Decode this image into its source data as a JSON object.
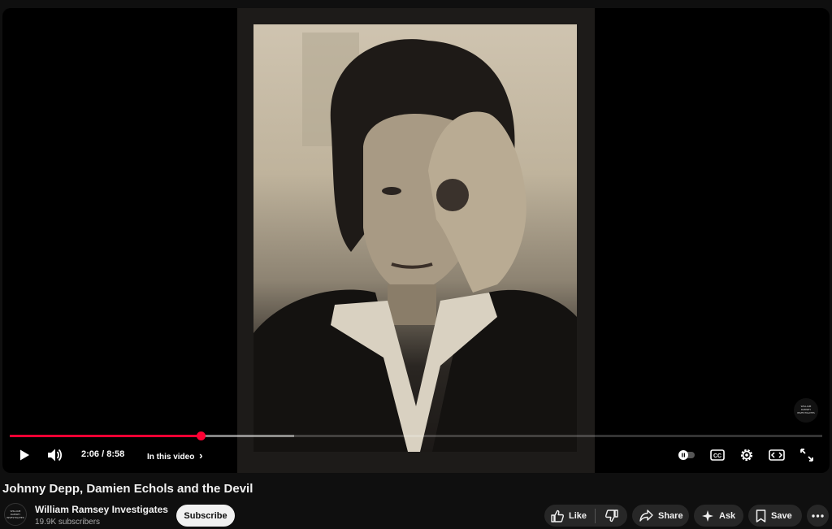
{
  "player": {
    "current_time": "2:06",
    "separator": " / ",
    "duration": "8:58",
    "chapter_label": "In this video",
    "chapter_chevron": "›",
    "progress_played": 0.235,
    "progress_buffered": 0.35,
    "watermark": [
      "WILLIAM",
      "RAMSEY",
      "INVESTIGATES"
    ],
    "icons": [
      "play-icon",
      "volume-icon",
      "autoplay-toggle-icon",
      "captions-icon",
      "settings-icon",
      "theater-mode-icon",
      "fullscreen-icon"
    ]
  },
  "video": {
    "title": "Johnny Depp, Damien Echols and the Devil"
  },
  "channel": {
    "name": "William Ramsey Investigates",
    "subscribers": "19.9K subscribers",
    "avatar_text": [
      "WILLIAM",
      "RAMSEY",
      "INVESTIGATES"
    ],
    "subscribe_label": "Subscribe"
  },
  "actions": {
    "like_label": "Like",
    "share_label": "Share",
    "ask_label": "Ask",
    "save_label": "Save",
    "icons": [
      "thumbs-up-icon",
      "thumbs-down-icon",
      "share-icon",
      "sparkle-icon",
      "bookmark-icon",
      "more-icon"
    ]
  },
  "colors": {
    "background": "#0f0f0f",
    "progress": "#ff0033",
    "pill": "#272727",
    "subscribe_bg": "#f1f1f1"
  }
}
